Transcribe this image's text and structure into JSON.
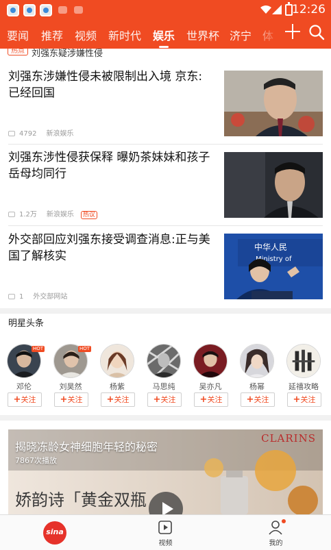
{
  "status_bar": {
    "time": "12:26"
  },
  "tabs": [
    "要闻",
    "推荐",
    "视频",
    "新时代",
    "娱乐",
    "世界杯",
    "济宁",
    "体育"
  ],
  "active_tab": "娱乐",
  "topic": {
    "tag": "热点",
    "text": "刘强东疑涉嫌性侵"
  },
  "news": [
    {
      "title": "刘强东涉嫌性侵未被限制出入境 京东:已经回国",
      "comments": "4792",
      "source": "新浪娱乐",
      "hot": ""
    },
    {
      "title": "刘强东涉性侵获保释 曝奶茶妹妹和孩子岳母均同行",
      "comments": "1.2万",
      "source": "新浪娱乐",
      "hot": "热议"
    },
    {
      "title": "外交部回应刘强东接受调查消息:正与美国了解核实",
      "comments": "1",
      "source": "外交部网站",
      "hot": ""
    }
  ],
  "stars_section": {
    "title": "明星头条",
    "follow_label": "关注",
    "hot_badge": "HOT",
    "stars": [
      {
        "name": "邓伦",
        "hot": true
      },
      {
        "name": "刘昊然",
        "hot": true
      },
      {
        "name": "杨紫",
        "hot": false
      },
      {
        "name": "马思纯",
        "hot": false
      },
      {
        "name": "吴亦凡",
        "hot": false
      },
      {
        "name": "杨幂",
        "hot": false
      },
      {
        "name": "延禧攻略",
        "hot": false
      }
    ]
  },
  "video": {
    "title": "揭晓冻龄女神细胞年轻的秘密",
    "plays": "7867次播放",
    "brand": "CLARINS",
    "ad_text": "娇韵诗「黄金双瓶"
  },
  "bottom_bar": {
    "video_label": "视频",
    "me_label": "我的",
    "logo_text": "sina"
  },
  "colors": {
    "brand": "#f04b22",
    "text": "#111111",
    "meta": "#9a9a9a"
  }
}
